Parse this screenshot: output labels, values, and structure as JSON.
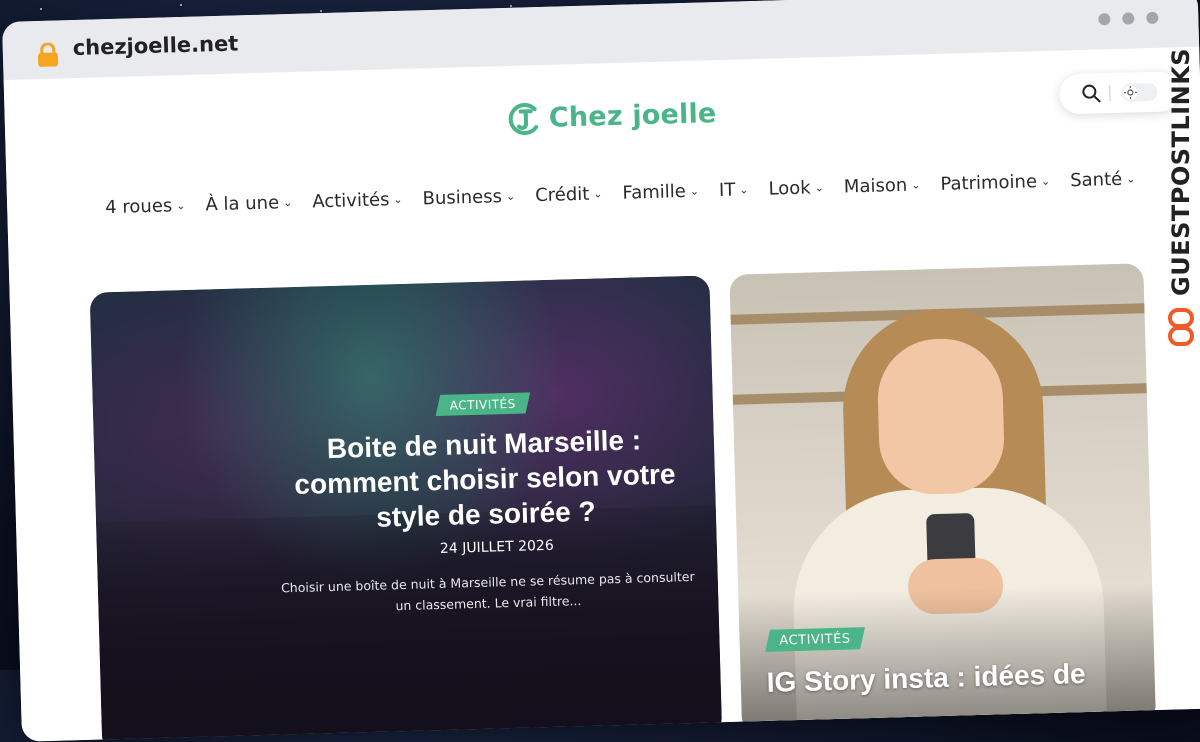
{
  "browser": {
    "url": "chezjoelle.net"
  },
  "site": {
    "logo_text": "Chez joelle"
  },
  "nav": {
    "items": [
      {
        "label": "4 roues"
      },
      {
        "label": "À la une"
      },
      {
        "label": "Activités"
      },
      {
        "label": "Business"
      },
      {
        "label": "Crédit"
      },
      {
        "label": "Famille"
      },
      {
        "label": "IT"
      },
      {
        "label": "Look"
      },
      {
        "label": "Maison"
      },
      {
        "label": "Patrimoine"
      },
      {
        "label": "Santé"
      }
    ]
  },
  "featured": [
    {
      "category": "ACTIVITÉS",
      "title": "Boite de nuit Marseille : comment choisir selon votre style de soirée ?",
      "date": "24 JUILLET 2026",
      "excerpt": "Choisir une boîte de nuit à Marseille ne se résume pas à consulter un classement. Le vrai filtre..."
    },
    {
      "category": "ACTIVITÉS",
      "title": "IG Story insta : idées de"
    }
  ],
  "watermark": {
    "text": "GUESTPOSTLINKS"
  },
  "colors": {
    "accent": "#4bb488",
    "watermark_accent": "#f05a28"
  }
}
